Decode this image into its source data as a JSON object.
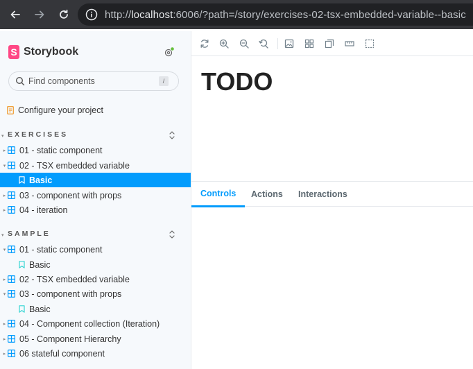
{
  "browser": {
    "url_prefix": "http://",
    "url_host": "localhost",
    "url_rest": ":6006/?path=/story/exercises-02-tsx-embedded-variable--basic"
  },
  "sidebar": {
    "brand": "Storybook",
    "search_placeholder": "Find components",
    "search_shortcut": "/",
    "configure_label": "Configure your project",
    "sections": [
      {
        "title": "EXERCISES",
        "items": [
          {
            "label": "01 - static component",
            "type": "component"
          },
          {
            "label": "02 - TSX embedded variable",
            "type": "component",
            "expanded": true
          },
          {
            "label": "Basic",
            "type": "story",
            "selected": true
          },
          {
            "label": "03 - component with props",
            "type": "component"
          },
          {
            "label": "04 - iteration",
            "type": "component"
          }
        ]
      },
      {
        "title": "SAMPLE",
        "items": [
          {
            "label": "01 - static component",
            "type": "component",
            "expanded": true
          },
          {
            "label": "Basic",
            "type": "story"
          },
          {
            "label": "02 - TSX embedded variable",
            "type": "component"
          },
          {
            "label": "03 - component with props",
            "type": "component",
            "expanded": true
          },
          {
            "label": "Basic",
            "type": "story"
          },
          {
            "label": "04 - Component collection (Iteration)",
            "type": "component"
          },
          {
            "label": "05 - Component Hierarchy",
            "type": "component"
          },
          {
            "label": "06 stateful component",
            "type": "component"
          }
        ]
      }
    ]
  },
  "canvas": {
    "heading": "TODO"
  },
  "addons": {
    "tabs": [
      "Controls",
      "Actions",
      "Interactions"
    ],
    "active_tab": "Controls"
  },
  "colors": {
    "accent": "#029cfd",
    "brand": "#ff4785",
    "sidebar_bg": "#f6f9fc",
    "chrome_bg": "#35363a"
  }
}
